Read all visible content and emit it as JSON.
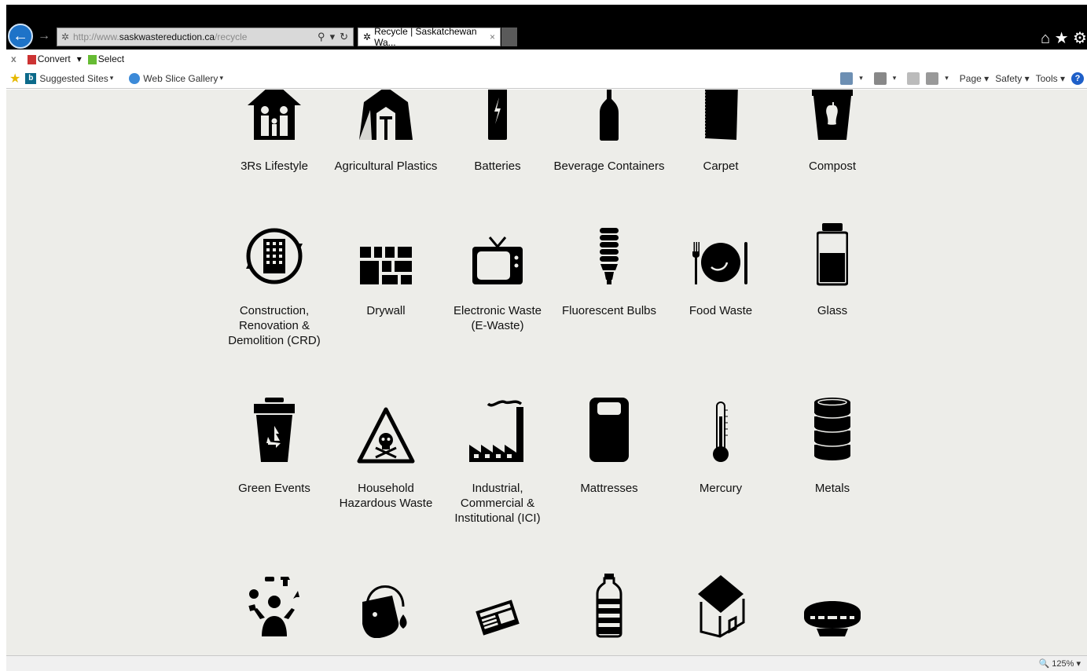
{
  "browser": {
    "url_prefix": "http://www.",
    "url_domain": "saskwastereduction.ca",
    "url_path": "/recycle",
    "tab_title": "Recycle | Saskatchewan Wa...",
    "tab_close": "×",
    "back_glyph": "←",
    "forward_glyph": "→",
    "search_glyph": "⚲",
    "refresh_glyph": "↻",
    "tools_glyphs": "⌂ ★ ⚙",
    "cmd_close": "x",
    "convert_label": "Convert",
    "select_label": "Select",
    "suggested_sites": "Suggested Sites",
    "web_slice_gallery": "Web Slice Gallery",
    "page_menu": "Page",
    "safety_menu": "Safety",
    "tools_menu": "Tools",
    "caret": "▾",
    "help_glyph": "?",
    "zoom": "125%",
    "zoom_glyph": "🔍"
  },
  "categories": {
    "r1": [
      "3Rs Lifestyle",
      "Agricultural Plastics",
      "Batteries",
      "Beverage Containers",
      "Carpet",
      "Compost"
    ],
    "r2c1": [
      "Construction,",
      "Renovation &",
      "Demolition (CRD)"
    ],
    "r2c2": [
      "Drywall"
    ],
    "r2c3": [
      "Electronic Waste",
      "(E-Waste)"
    ],
    "r2c4": [
      "Fluorescent Bulbs"
    ],
    "r2c5": [
      "Food Waste"
    ],
    "r2c6": [
      "Glass"
    ],
    "r3c1": [
      "Green Events"
    ],
    "r3c2": [
      "Household",
      "Hazardous Waste"
    ],
    "r3c3": [
      "Industrial,",
      "Commercial &",
      "Institutional (ICI)"
    ],
    "r3c4": [
      "Mattresses"
    ],
    "r3c5": [
      "Mercury"
    ],
    "r3c6": [
      "Metals"
    ]
  },
  "colors": {
    "content_bg": "#edede9",
    "icon": "#000000",
    "titlebar": "#000000",
    "accent": "#1e73c8"
  }
}
